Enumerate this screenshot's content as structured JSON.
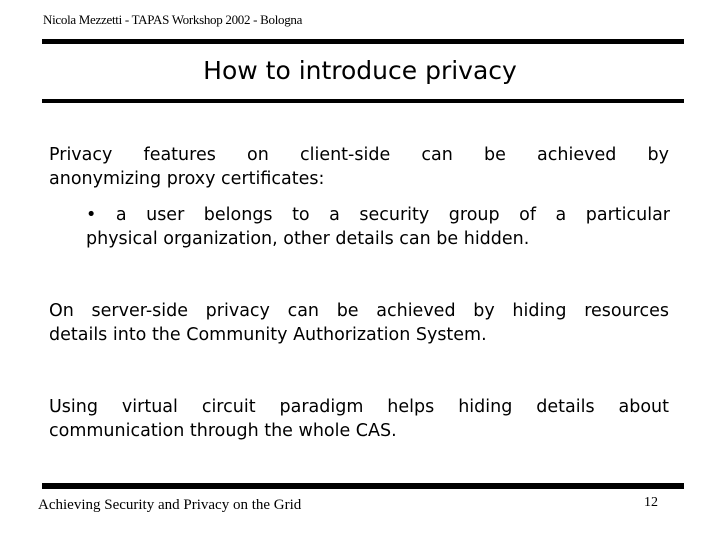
{
  "header": {
    "text": "Nicola Mezzetti - TAPAS Workshop 2002 - Bologna"
  },
  "slide": {
    "title": "How to introduce privacy",
    "paragraphs": [
      {
        "line1": "Privacy features on client-side can be achieved by",
        "line2": "anonymizing proxy certificates:"
      },
      {
        "line1": "On server-side privacy can be achieved by hiding resources",
        "line2": "details into the Community Authorization System."
      },
      {
        "line1": "Using virtual circuit paradigm helps hiding details about",
        "line2": "communication through the whole CAS."
      }
    ],
    "bullets": [
      {
        "marker": "•",
        "line1": "a user belongs to a security group of a particular",
        "line2": "physical organization, other details can be hidden."
      }
    ]
  },
  "footer": {
    "text": "Achieving Security and Privacy on the Grid",
    "page_number": "12"
  }
}
